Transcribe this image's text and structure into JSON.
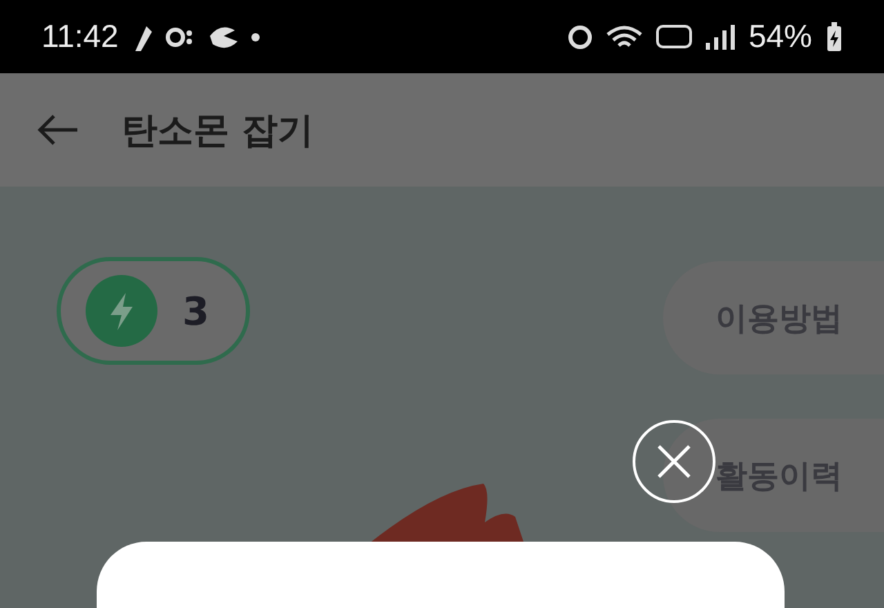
{
  "status_bar": {
    "time": "11:42",
    "battery": "54%"
  },
  "header": {
    "title": "탄소몬 잡기"
  },
  "energy_badge": {
    "count": "3"
  },
  "side_buttons": [
    {
      "label": "이용방법"
    },
    {
      "label": "활동이력"
    }
  ]
}
